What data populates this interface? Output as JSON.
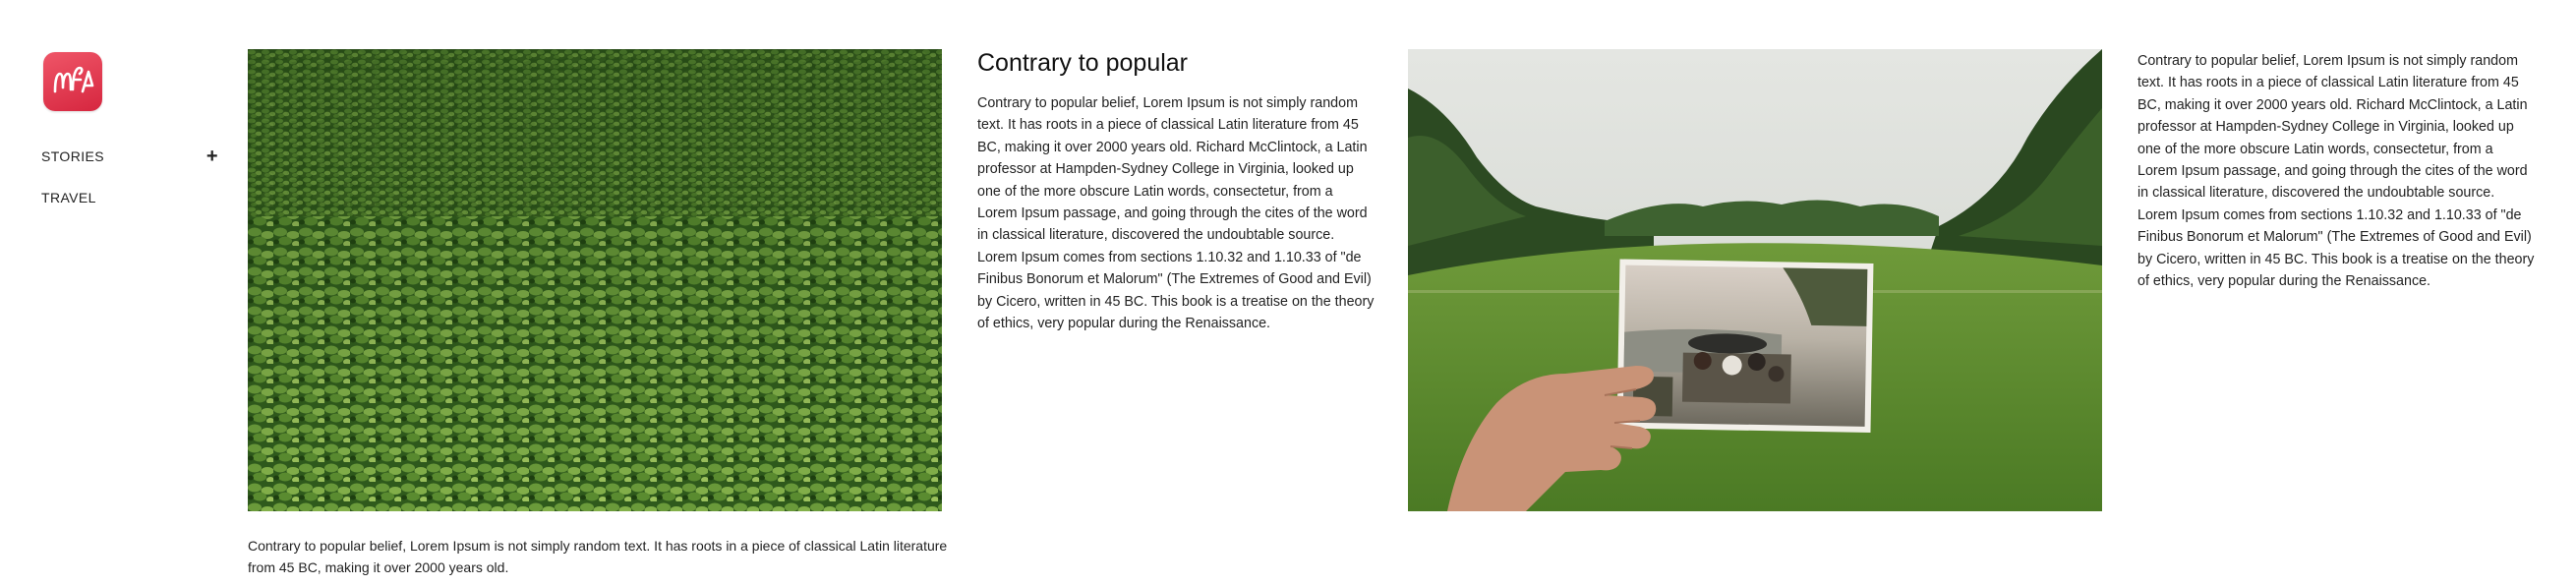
{
  "brand": {
    "logo_icon": "mf-logo-icon",
    "accent": "#e23b52"
  },
  "nav": {
    "items": [
      {
        "label": "STORIES",
        "expand_icon": "+"
      },
      {
        "label": "TRAVEL"
      }
    ]
  },
  "feed": {
    "photo1": {
      "caption": "Contrary to popular belief, Lorem Ipsum is not simply random text. It has roots in a piece of classical Latin literature from 45 BC, making it over 2000 years old."
    },
    "article1": {
      "title": "Contrary to popular",
      "body": "Contrary to popular belief, Lorem Ipsum is not simply random text. It has roots in a piece of classical Latin literature from 45 BC, making it over 2000 years old. Richard McClintock, a Latin professor at Hampden-Sydney College in Virginia, looked up one of the more obscure Latin words, consectetur, from a Lorem Ipsum passage, and going through the cites of the word in classical literature, discovered the undoubtable source. Lorem Ipsum comes from sections 1.10.32 and 1.10.33 of \"de Finibus Bonorum et Malorum\" (The Extremes of Good and Evil) by Cicero, written in 45 BC. This book is a treatise on the theory of ethics, very popular during the Renaissance."
    },
    "article2": {
      "body": "Contrary to popular belief, Lorem Ipsum is not simply random text. It has roots in a piece of classical Latin literature from 45 BC, making it over 2000 years old. Richard McClintock, a Latin professor at Hampden-Sydney College in Virginia, looked up one of the more obscure Latin words, consectetur, from a Lorem Ipsum passage, and going through the cites of the word in classical literature, discovered the undoubtable source. Lorem Ipsum comes from sections 1.10.32 and 1.10.33 of \"de Finibus Bonorum et Malorum\" (The Extremes of Good and Evil) by Cicero, written in 45 BC. This book is a treatise on the theory of ethics, very popular during the Renaissance."
    }
  }
}
